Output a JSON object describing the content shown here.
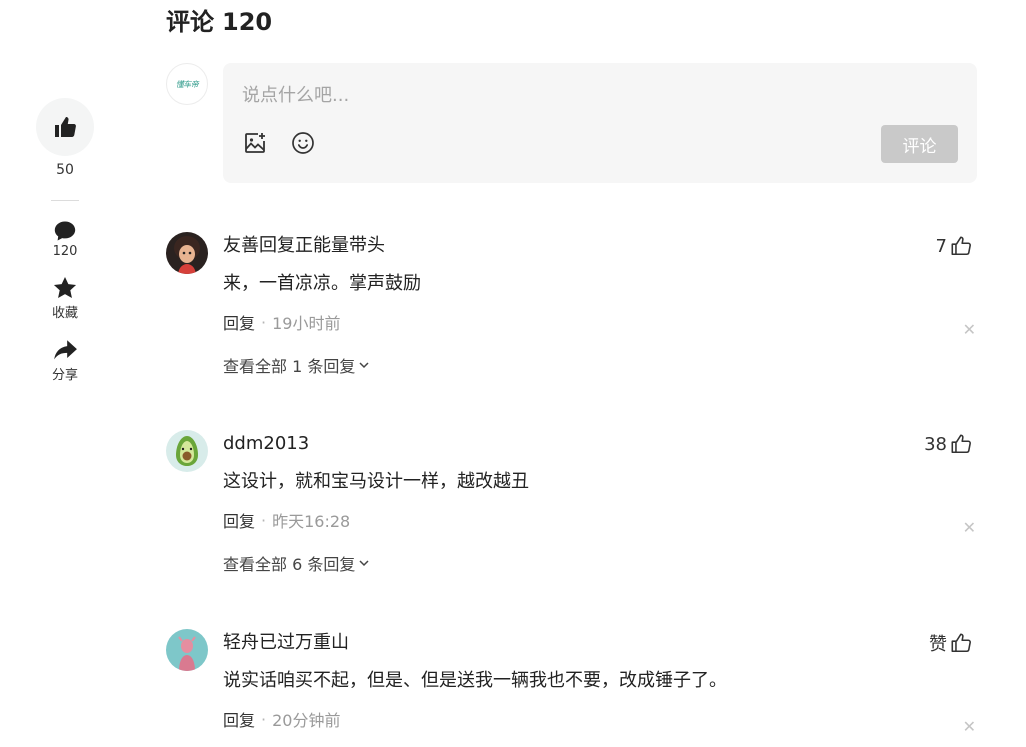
{
  "header": {
    "title": "评论",
    "count": "120"
  },
  "rail": {
    "like_count": "50",
    "comment_count": "120",
    "favorite_label": "收藏",
    "share_label": "分享"
  },
  "composer": {
    "avatar_logo": "懂车帝",
    "placeholder": "说点什么吧...",
    "submit_label": "评论"
  },
  "comments": [
    {
      "name": "友善回复正能量带头",
      "text": "来，一首凉凉。掌声鼓励",
      "reply_label": "回复",
      "time": "19小时前",
      "likes": "7",
      "more_replies": "查看全部 1 条回复",
      "avatar_icon": "cartoon-girl-avatar"
    },
    {
      "name": "ddm2013",
      "text": "这设计，就和宝马设计一样，越改越丑",
      "reply_label": "回复",
      "time": "昨天16:28",
      "likes": "38",
      "more_replies": "查看全部 6 条回复",
      "avatar_icon": "avocado-avatar"
    },
    {
      "name": "轻舟已过万重山",
      "text": "说实话咱买不起，但是、但是送我一辆我也不要，改成锤子了。",
      "reply_label": "回复",
      "time": "20分钟前",
      "likes": "赞",
      "avatar_icon": "pink-figure-avatar"
    }
  ],
  "colors": {
    "rail_circle": "#f4f5f5",
    "composer_bg": "#f6f6f6",
    "submit_disabled": "#c9c9c9",
    "muted_text": "#9a9a9a"
  }
}
